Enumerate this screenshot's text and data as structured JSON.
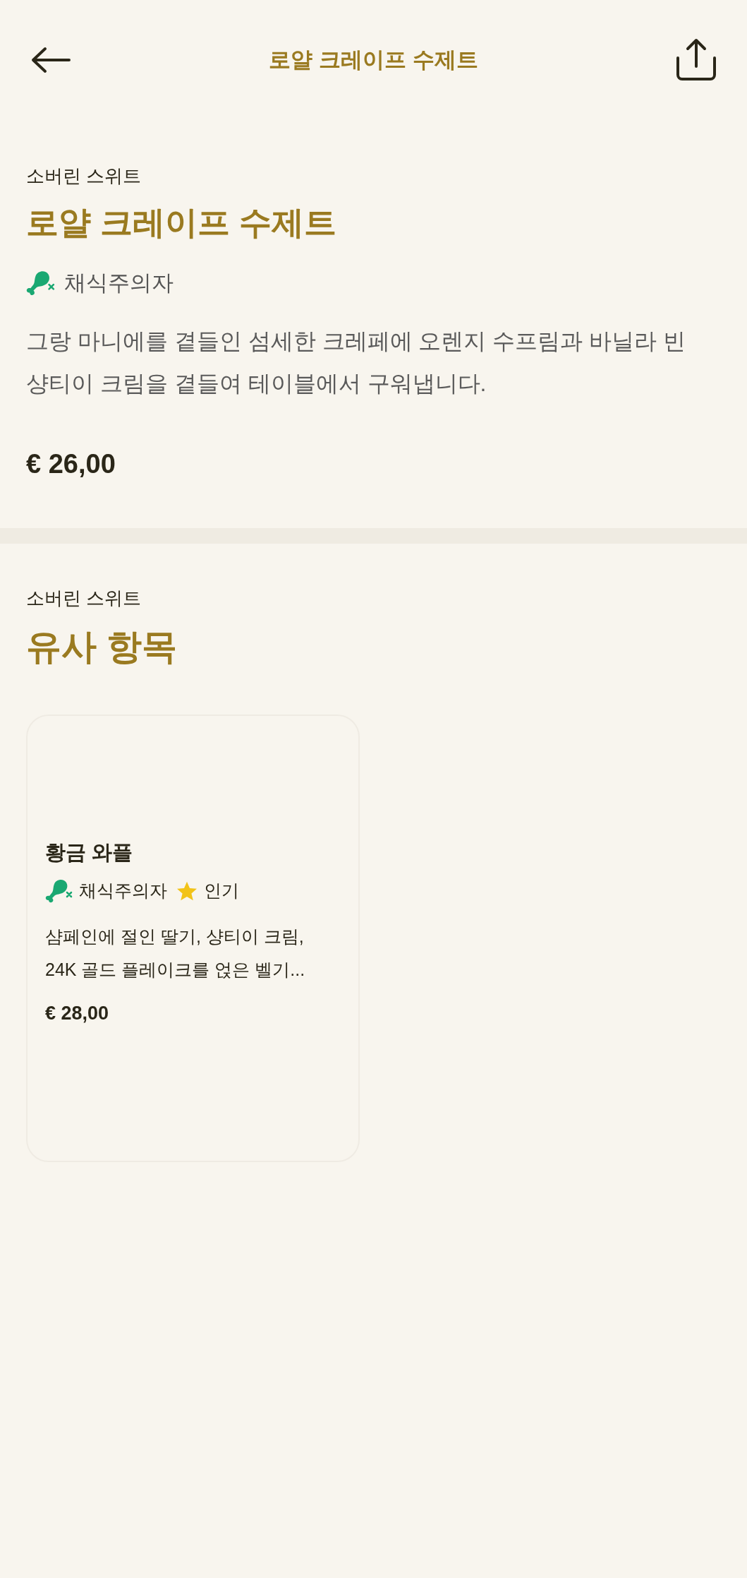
{
  "header": {
    "title": "로얄 크레이프 수제트"
  },
  "item": {
    "category": "소버린 스위트",
    "name": "로얄 크레이프 수제트",
    "tags": [
      {
        "kind": "vegetarian",
        "label": "채식주의자"
      }
    ],
    "description": "그랑 마니에를 곁들인 섬세한 크레페에 오렌지 수프림과 바닐라 빈 샹티이 크림을 곁들여 테이블에서 구워냅니다.",
    "price": "€ 26,00"
  },
  "similar": {
    "category": "소버린 스위트",
    "heading": "유사 항목",
    "cards": [
      {
        "name": "황금 와플",
        "tags": [
          {
            "kind": "vegetarian",
            "label": "채식주의자"
          },
          {
            "kind": "popular",
            "label": "인기"
          }
        ],
        "description": "샴페인에 절인 딸기, 샹티이 크림, 24K 골드 플레이크를 얹은 벨기...",
        "price": "€ 28,00"
      }
    ]
  }
}
